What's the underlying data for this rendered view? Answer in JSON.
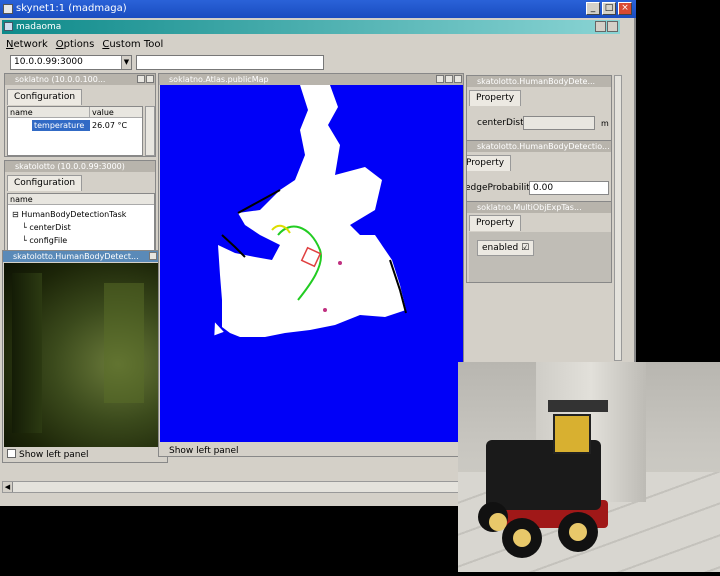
{
  "window": {
    "title": "skynet1:1 (madmaga)",
    "subwindow_title": "madaoma"
  },
  "menu": [
    "Network",
    "Options",
    "Custom Tool"
  ],
  "address": {
    "value": "10.0.0.99:3000"
  },
  "config_panel_1": {
    "title": "soklatno (10.0.0.100...",
    "tab": "Configuration",
    "columns": [
      "name",
      "value"
    ],
    "rows": [
      {
        "name": "temperature",
        "value": "26.07 °C"
      }
    ]
  },
  "config_panel_2": {
    "title": "skatolotto (10.0.0.99:3000)",
    "tab": "Configuration",
    "columns": [
      "name"
    ],
    "tree": [
      "HumanBodyDetectionTask",
      "centerDist",
      "configFile"
    ]
  },
  "camera_panel": {
    "title": "skatolotto.HumanBodyDetect...",
    "checkbox": "Show left panel"
  },
  "map_panel": {
    "title": "soklatno.Atlas.publicMap",
    "checkbox": "Show left panel"
  },
  "prop_panel_1": {
    "title": "skatolotto.HumanBodyDete...",
    "tab": "Property",
    "field_label": "centerDist",
    "unit": "m"
  },
  "prop_panel_2": {
    "title": "skatolotto.HumanBodyDetectio...",
    "tab": "Property",
    "field_label": "edgeProbability",
    "field_value": "0.00"
  },
  "prop_panel_3": {
    "title": "soklatno.MultiObjExpTas...",
    "tab": "Property",
    "check_label": "enabled"
  },
  "colors": {
    "title_bar": "#2a62d8",
    "map_bg": "#0000f8",
    "caption_teal": "#0e8a8a"
  }
}
